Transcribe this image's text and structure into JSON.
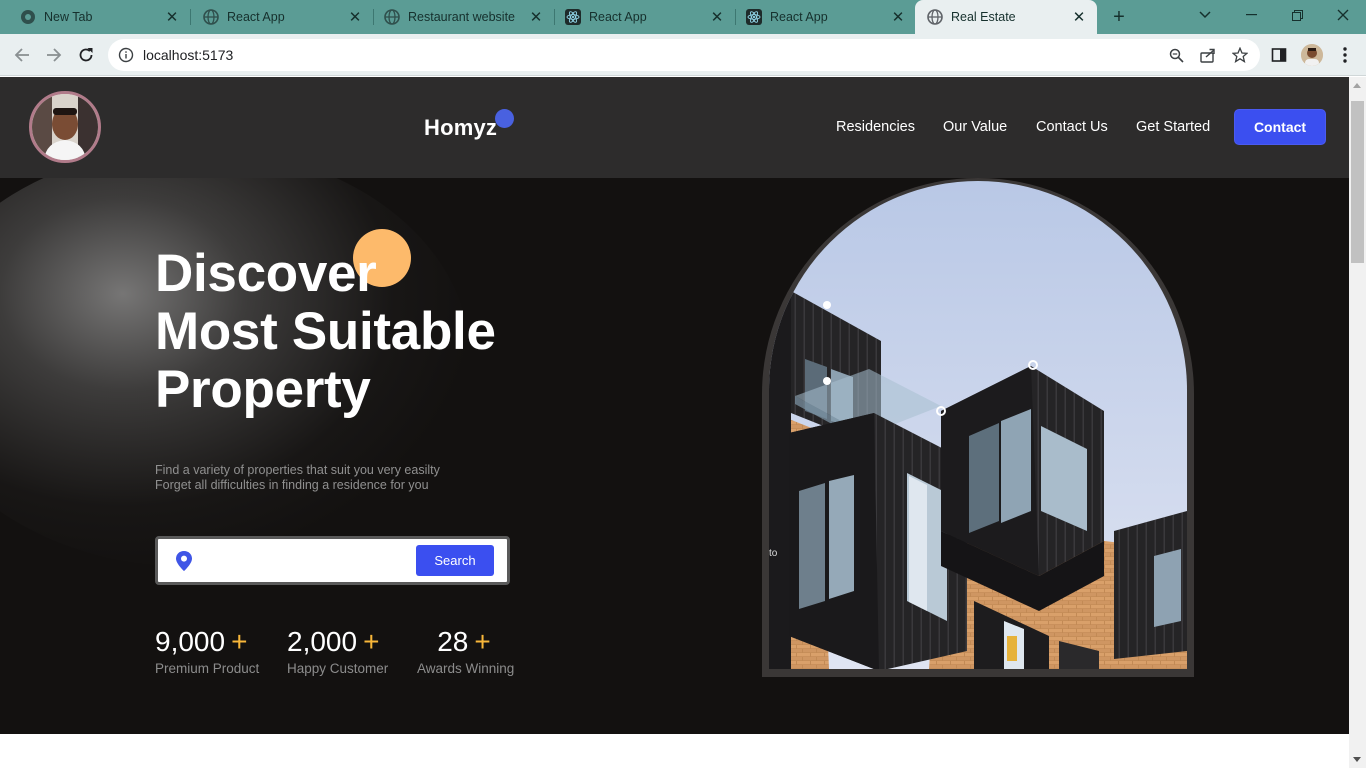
{
  "browser": {
    "tabs": [
      {
        "title": "New Tab",
        "icon": "chrome-icon",
        "active": false
      },
      {
        "title": "React App",
        "icon": "globe-icon",
        "active": false
      },
      {
        "title": "Restaurant website",
        "icon": "globe-icon",
        "active": false
      },
      {
        "title": "React App",
        "icon": "react-icon",
        "active": false
      },
      {
        "title": "React App",
        "icon": "react-icon",
        "active": false
      },
      {
        "title": "Real Estate",
        "icon": "globe-icon",
        "active": true
      }
    ],
    "url": "localhost:5173",
    "colors": {
      "tab_strip": "#5b9c95",
      "toolbar": "#e9eff0"
    }
  },
  "header": {
    "logo": "Homyz",
    "nav": [
      "Residencies",
      "Our Value",
      "Contact Us",
      "Get Started"
    ],
    "contact_label": "Contact",
    "colors": {
      "background": "#2d2c2c",
      "accent": "#3b4ff0",
      "logo_dot": "#4961e0"
    }
  },
  "hero": {
    "headline": [
      "Discover",
      "Most Suitable",
      "Property"
    ],
    "subtitle": [
      "Find a variety of properties that suit you very easilty",
      "Forget all difficulties in finding a residence for you"
    ],
    "search": {
      "placeholder": "",
      "button_label": "Search",
      "icon": "location-pin-icon"
    },
    "stats": [
      {
        "value": "9,000",
        "suffix": "+",
        "label": "Premium Product"
      },
      {
        "value": "2,000",
        "suffix": "+",
        "label": "Happy Customer"
      },
      {
        "value": "28",
        "suffix": "+",
        "label": "Awards Winning"
      }
    ],
    "image_overlay_text": "to",
    "colors": {
      "background": "#131110",
      "orange_circle": "#fdba6b",
      "plus": "#f8b73a"
    }
  }
}
